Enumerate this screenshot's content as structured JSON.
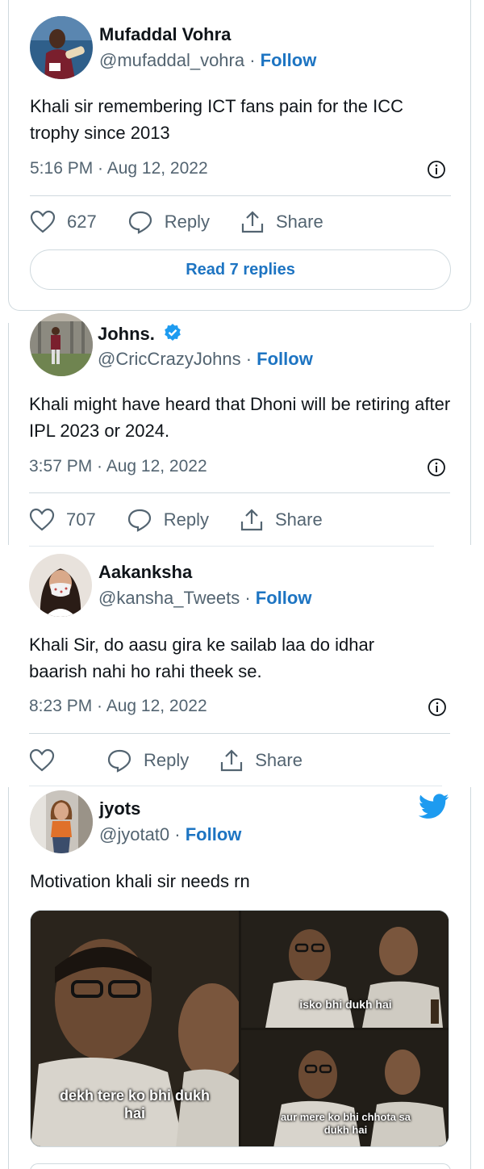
{
  "tweets": [
    {
      "name": "Mufaddal Vohra",
      "handle": "@mufaddal_vohra",
      "follow": "Follow",
      "text": "Khali sir remembering ICT fans pain for the ICC trophy since 2013",
      "time": "5:16 PM · Aug 12, 2022",
      "likes": "627",
      "reply": "Reply",
      "share": "Share",
      "read_replies": "Read 7 replies"
    },
    {
      "name": "Johns.",
      "handle": "@CricCrazyJohns",
      "follow": "Follow",
      "text": "Khali might have heard that Dhoni will be retiring after IPL 2023 or 2024.",
      "time": "3:57 PM · Aug 12, 2022",
      "likes": "707",
      "reply": "Reply",
      "share": "Share"
    },
    {
      "name": "Aakanksha",
      "handle": "@kansha_Tweets",
      "follow": "Follow",
      "text": "Khali Sir, do aasu gira ke sailab laa do idhar baarish nahi ho rahi theek se.",
      "time": "8:23 PM · Aug 12, 2022",
      "reply": "Reply",
      "share": "Share"
    },
    {
      "name": "jyots",
      "handle": "@jyotat0",
      "follow": "Follow",
      "text": "Motivation khali sir needs rn",
      "media_captions": [
        "dekh tere ko bhi dukh hai",
        "isko bhi dukh hai",
        "aur mere ko bhi chhota sa dukh hai"
      ]
    }
  ],
  "separator": " · ",
  "colors": {
    "accent": "#1d74c2",
    "secondary_text": "#536471",
    "border": "#cfd9de",
    "twitter_blue": "#1d9bf0",
    "verified": "#1d9bf0"
  }
}
